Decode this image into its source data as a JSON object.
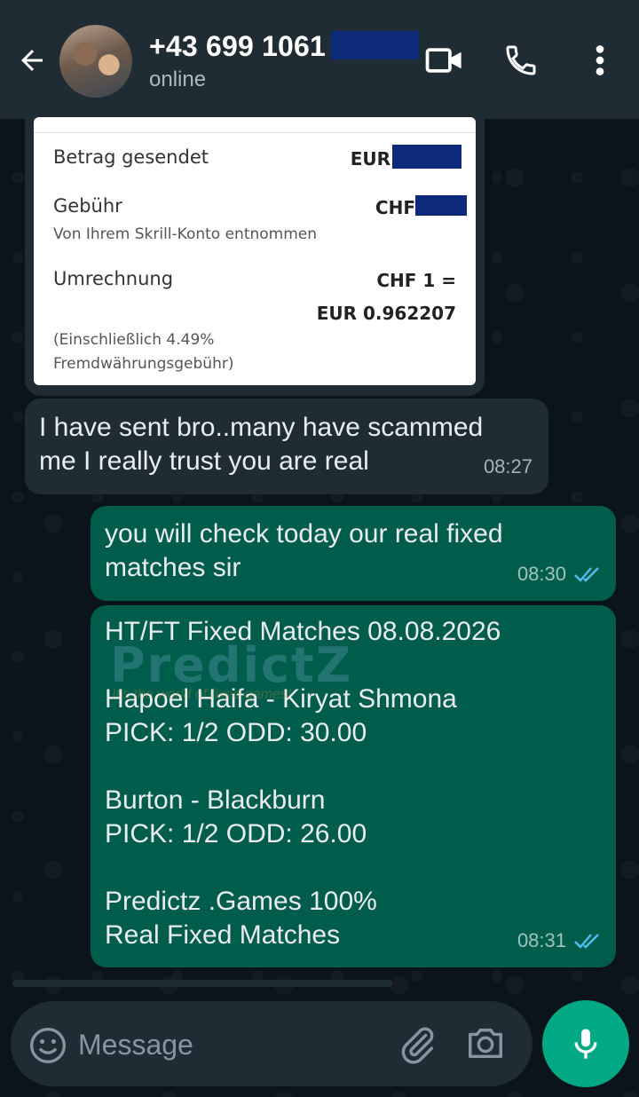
{
  "header": {
    "contact_name": "+43 699 1061",
    "status": "online"
  },
  "receipt": {
    "sent_label": "Betrag gesendet",
    "sent_currency": "EUR",
    "fee_label": "Gebühr",
    "fee_currency": "CHF",
    "fee_note": "Von Ihrem Skrill-Konto entnommen",
    "conversion_label": "Umrechnung",
    "conversion_rate_line1": "CHF 1 =",
    "conversion_rate_line2": "EUR 0.962207",
    "conversion_note": "(Einschließlich 4.49%\nFremdwährungsgebühr)"
  },
  "messages": [
    {
      "direction": "in",
      "text": "I have sent bro..many have scammed\nme I really trust you are real",
      "time": "08:27"
    },
    {
      "direction": "out",
      "text": "you will check today our real fixed\nmatches sir",
      "time": "08:30",
      "status": "read"
    },
    {
      "direction": "out",
      "text": "HT/FT Fixed Matches 08.08.2026\n\nHapoel Haifa - Kiryat Shmona\nPICK: 1/2 ODD: 30.00\n\nBurton - Blackburn\nPICK: 1/2  ODD: 26.00\n\nPredictz .Games 100%\nReal Fixed Matches",
      "time": "08:31",
      "status": "read"
    }
  ],
  "watermark": {
    "title": "PredictZ",
    "subtitle": "It's the world of fixed games!"
  },
  "composer": {
    "placeholder": "Message"
  },
  "colors": {
    "header_bg": "#1f2c34",
    "chat_bg": "#0b141a",
    "incoming_bubble": "#1f2c34",
    "outgoing_bubble": "#005c4b",
    "accent": "#00a884",
    "read_ticks": "#53bdeb"
  },
  "icons": [
    "back-arrow-icon",
    "video-call-icon",
    "phone-icon",
    "more-options-icon",
    "emoji-icon",
    "attach-icon",
    "camera-icon",
    "mic-icon",
    "double-check-icon"
  ]
}
